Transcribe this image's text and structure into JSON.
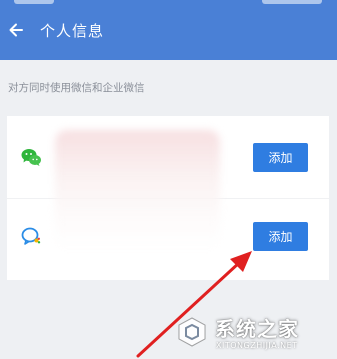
{
  "header": {
    "title": "个人信息",
    "background": "#4a80d6"
  },
  "hint": "对方同时使用微信和企业微信",
  "contacts": [
    {
      "app": "wechat-icon",
      "button_label": "添加"
    },
    {
      "app": "wework-icon",
      "button_label": "添加"
    }
  ],
  "colors": {
    "button": "#2f7de1",
    "annotation_arrow": "#e02020",
    "page_background": "#eef0f3"
  },
  "watermark": {
    "name": "系统之家",
    "url": "XITONGZHIJIA.NET"
  }
}
